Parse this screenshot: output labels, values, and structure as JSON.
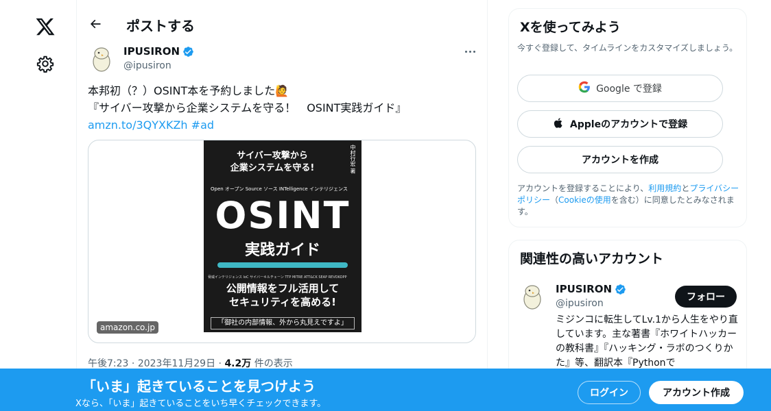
{
  "nav": {
    "logo": "x-logo-icon",
    "settings": "gear-icon"
  },
  "header": {
    "title": "ポストする",
    "back_icon": "arrow-left-icon"
  },
  "post": {
    "author_name": "IPUSIRON",
    "author_handle": "@ipusiron",
    "lines": [
      "本邦初（？）OSINT本を予約しました🙋",
      "『サイバー攻撃から企業システムを守る！　OSINT実践ガイド』"
    ],
    "link": "amzn.to/3QYXKZh",
    "hashtag": "#ad",
    "card": {
      "domain": "amazon.co.jp",
      "book": {
        "top_line1": "サイバー攻撃から",
        "top_line2": "企業システムを守る!",
        "author": "中村行宏 著",
        "subtitle_small": "Open オープン  Source ソース  INTelligence インテリジェンス",
        "main_title": "OSINT",
        "sub_title": "実践ガイド",
        "tags": "脅威インテリジェンス  IoC  サイバーキルチェーン  TTP  MITRE ATT&CK  SEAP  REVOKOPP",
        "catch_line1": "公開情報をフル活用して",
        "catch_line2": "セキュリティを高める!",
        "bottom": "「御社の内部情報、外から丸見えですよ」"
      }
    },
    "time": "午後7:23",
    "date": "2023年11月29日",
    "views_count": "4.2万",
    "views_label": "件の表示"
  },
  "signup_panel": {
    "title": "Xを使ってみよう",
    "subtitle": "今すぐ登録して、タイムラインをカスタマイズしましょう。",
    "google_label": "Google で登録",
    "apple_label": "Appleのアカウントで登録",
    "create_label": "アカウントを作成",
    "legal_pre": "アカウントを登録することにより、",
    "legal_terms": "利用規約",
    "legal_and": "と",
    "legal_privacy": "プライバシーポリシー",
    "legal_open": "（",
    "legal_cookie": "Cookieの使用",
    "legal_post": "を含む）に同意したとみなされます。"
  },
  "recommend": {
    "title": "関連性の高いアカウント",
    "name": "IPUSIRON",
    "handle": "@ipusiron",
    "follow_label": "フォロー",
    "bio": "ミジンコに転生してLv.1から人生をやり直しています。主な著書『ホワイトハッカーの教科書』『ハッキング・ラボのつくりかた』等、翻訳本『Pythonで"
  },
  "bottom_bar": {
    "title": "「いま」起きていることを見つけよう",
    "subtitle": "Xなら、「いま」起きていることをいち早くチェックできます。",
    "login_label": "ログイン",
    "signup_label": "アカウント作成"
  },
  "colors": {
    "accent": "#1d9bf0",
    "text": "#0f1419",
    "muted": "#536471",
    "verified": "#1d9bf0"
  }
}
